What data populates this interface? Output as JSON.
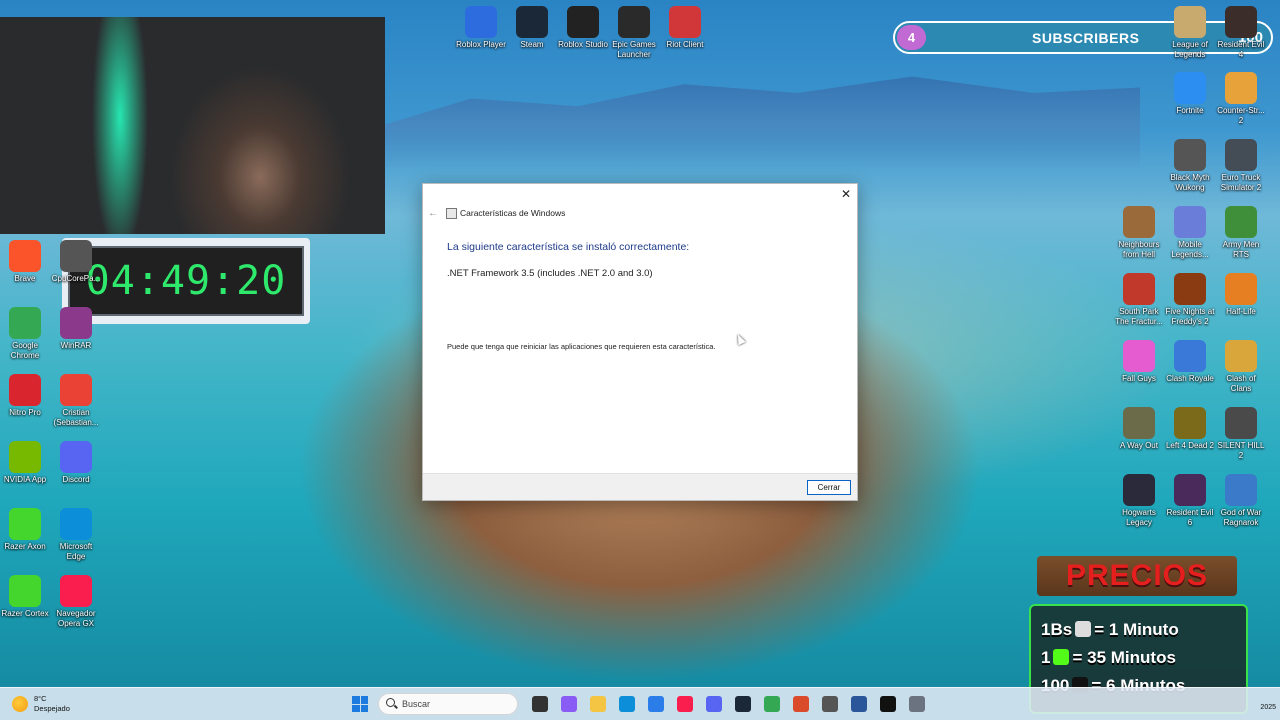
{
  "desktop": {
    "top_icons": [
      {
        "label": "Roblox Player",
        "icon": "roblox-player-icon",
        "color": "#2d6cdf"
      },
      {
        "label": "Steam",
        "icon": "steam-icon",
        "color": "#1b2838"
      },
      {
        "label": "Roblox Studio",
        "icon": "roblox-studio-icon",
        "color": "#222222"
      },
      {
        "label": "Epic Games Launcher",
        "icon": "epic-games-icon",
        "color": "#2a2a2a"
      },
      {
        "label": "Riot Client",
        "icon": "riot-client-icon",
        "color": "#d13639"
      }
    ],
    "left_icons": [
      {
        "label": "Brave",
        "icon": "brave-icon",
        "color": "#fb542b"
      },
      {
        "label": "CpuCorePa...",
        "icon": "cpu-icon",
        "color": "#555555"
      },
      {
        "label": "Google Chrome",
        "icon": "chrome-icon",
        "color": "#34a853"
      },
      {
        "label": "WinRAR",
        "icon": "winrar-icon",
        "color": "#8b3a8b"
      },
      {
        "label": "Nitro Pro",
        "icon": "nitro-pro-icon",
        "color": "#d9262e"
      },
      {
        "label": "Cristian (Sebastian...",
        "icon": "chrome-profile-icon",
        "color": "#ea4335"
      },
      {
        "label": "NVIDIA App",
        "icon": "nvidia-icon",
        "color": "#76b900"
      },
      {
        "label": "Discord",
        "icon": "discord-icon",
        "color": "#5865f2"
      },
      {
        "label": "Razer Axon",
        "icon": "razer-axon-icon",
        "color": "#44d62c"
      },
      {
        "label": "Microsoft Edge",
        "icon": "edge-icon",
        "color": "#0c8ed9"
      },
      {
        "label": "Razer Cortex",
        "icon": "razer-cortex-icon",
        "color": "#44d62c"
      },
      {
        "label": "Navegador Opera GX",
        "icon": "opera-gx-icon",
        "color": "#fa1e4e"
      }
    ],
    "right_icons": [
      {
        "label": "League of Legends",
        "icon": "league-icon",
        "color": "#c8aa6e"
      },
      {
        "label": "Resident Evil 4",
        "icon": "re4-icon",
        "color": "#3a2d2a"
      },
      {
        "label": "Fortnite",
        "icon": "fortnite-icon",
        "color": "#2b8ef0"
      },
      {
        "label": "Counter-Str... 2",
        "icon": "cs2-icon",
        "color": "#e8a23a"
      },
      {
        "label": "Black Myth Wukong",
        "icon": "wukong-icon",
        "color": "#555555"
      },
      {
        "label": "Euro Truck Simulator 2",
        "icon": "ets2-icon",
        "color": "#444c56"
      },
      {
        "label": "Neighbours from Hell",
        "icon": "neighbours-icon",
        "color": "#9a6a3a"
      },
      {
        "label": "Mobile Legends...",
        "icon": "mobile-legends-icon",
        "color": "#6a7dd8"
      },
      {
        "label": "Army Men RTS",
        "icon": "army-men-icon",
        "color": "#3f8f3a"
      },
      {
        "label": "South Park The Fractur...",
        "icon": "south-park-icon",
        "color": "#c0392b"
      },
      {
        "label": "Five Nights at Freddy's 2",
        "icon": "fnaf2-icon",
        "color": "#8a3b12"
      },
      {
        "label": "Half-Life",
        "icon": "half-life-icon",
        "color": "#e67e22"
      },
      {
        "label": "Fall Guys",
        "icon": "fall-guys-icon",
        "color": "#e45cd0"
      },
      {
        "label": "Clash Royale",
        "icon": "clash-royale-icon",
        "color": "#3a79d8"
      },
      {
        "label": "Clash of Clans",
        "icon": "clash-clans-icon",
        "color": "#d8a63a"
      },
      {
        "label": "A Way Out",
        "icon": "a-way-out-icon",
        "color": "#6b6b4a"
      },
      {
        "label": "Left 4 Dead 2",
        "icon": "l4d2-icon",
        "color": "#7a6a1a"
      },
      {
        "label": "SILENT HILL 2",
        "icon": "silent-hill-icon",
        "color": "#4a4a4a"
      },
      {
        "label": "Hogwarts Legacy",
        "icon": "hogwarts-icon",
        "color": "#2a2a3a"
      },
      {
        "label": "Resident Evil 6",
        "icon": "re6-icon",
        "color": "#4a2a5a"
      },
      {
        "label": "God of War Ragnarok",
        "icon": "gow-icon",
        "color": "#3a7ac8"
      }
    ]
  },
  "overlays": {
    "timer": "04:49:20",
    "subscribers": {
      "current": "4",
      "label": "SUBSCRIBERS",
      "goal": "100",
      "fill": 0.04
    },
    "prices": {
      "title": "PRECIOS",
      "rows": [
        {
          "qty": "1Bs",
          "icon": "qr-icon",
          "icon_color": "#dddddd",
          "eq": "= 1 Minuto"
        },
        {
          "qty": "1",
          "icon": "kick-gift-icon",
          "icon_color": "#53fc18",
          "eq": "= 35 Minutos"
        },
        {
          "qty": "100",
          "icon": "kick-k-icon",
          "icon_color": "#111111",
          "eq": "= 6 Minutos"
        }
      ]
    }
  },
  "dialog": {
    "window_title": "Características de Windows",
    "heading": "La siguiente característica se instaló correctamente:",
    "feature": ".NET Framework 3.5 (includes .NET 2.0 and 3.0)",
    "note": "Puede que tenga que reiniciar las aplicaciones que requieren esta característica.",
    "close_button": "Cerrar",
    "close_glyph": "✕",
    "back_glyph": "←"
  },
  "taskbar": {
    "weather_temp": "8°C",
    "weather_desc": "Despejado",
    "search_placeholder": "Buscar",
    "year": "2025",
    "accent": "#1d7be0",
    "apps": [
      {
        "icon": "task-view-icon",
        "color": "#333333"
      },
      {
        "icon": "copilot-icon",
        "color": "#8a5cf6"
      },
      {
        "icon": "file-explorer-icon",
        "color": "#f4c542"
      },
      {
        "icon": "edge-icon",
        "color": "#0c8ed9"
      },
      {
        "icon": "store-icon",
        "color": "#2b7de9"
      },
      {
        "icon": "opera-gx-icon",
        "color": "#fa1e4e"
      },
      {
        "icon": "discord-icon",
        "color": "#5865f2"
      },
      {
        "icon": "steam-icon",
        "color": "#1b2838"
      },
      {
        "icon": "chrome-icon",
        "color": "#34a853"
      },
      {
        "icon": "obs-icon",
        "color": "#d94b2b"
      },
      {
        "icon": "settings-icon",
        "color": "#555555"
      },
      {
        "icon": "word-icon",
        "color": "#2b579a"
      },
      {
        "icon": "unreal-icon",
        "color": "#111111"
      },
      {
        "icon": "optional-features-icon",
        "color": "#6b7280"
      }
    ]
  }
}
